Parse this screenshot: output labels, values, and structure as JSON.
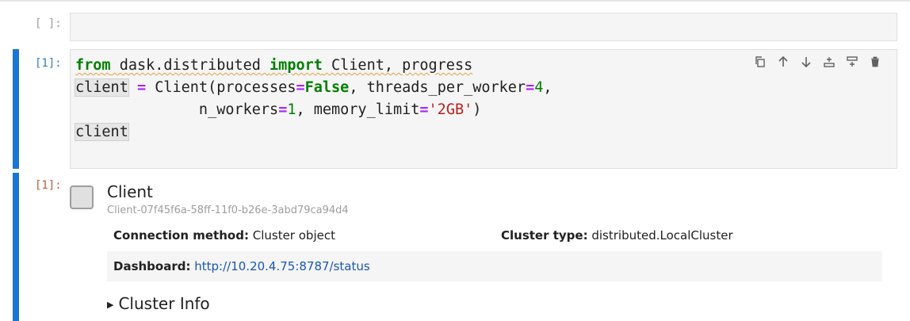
{
  "cells": {
    "empty": {
      "prompt": "[ ]:"
    },
    "code": {
      "prompt": "[1]:",
      "tokens": {
        "from": "from",
        "module": " dask.distributed ",
        "import": "import",
        "imports": " Client, progress",
        "client_var": "client",
        "eq": " = ",
        "call_open": "Client(processes",
        "eq2": "=",
        "false_kw": "False",
        "tpw": ", threads_per_worker",
        "eq3": "=",
        "four": "4",
        "comma_end": ",",
        "indent": "              n_workers",
        "eq4": "=",
        "one": "1",
        "memlim": ", memory_limit",
        "eq5": "=",
        "gb": "'2GB'",
        "close": ")",
        "client_last": "client"
      },
      "toolbar": {
        "copy": "copy-icon",
        "up": "arrow-up-icon",
        "down": "arrow-down-icon",
        "insert_above": "insert-above-icon",
        "insert_below": "insert-below-icon",
        "delete": "delete-icon"
      }
    },
    "output": {
      "prompt": "[1]:",
      "title": "Client",
      "client_id": "Client-07f45f6a-58ff-11f0-b26e-3abd79ca94d4",
      "connection_label": "Connection method:",
      "connection_value": "Cluster object",
      "cluster_type_label": "Cluster type:",
      "cluster_type_value": "distributed.LocalCluster",
      "dashboard_label": "Dashboard:",
      "dashboard_url": "http://10.20.4.75:8787/status",
      "cluster_info": "Cluster Info"
    }
  },
  "colors": {
    "active_bar": "#1976d2",
    "prompt_in": "#307fc1",
    "prompt_out": "#bf5b3d",
    "keyword": "#008000",
    "operator": "#aa22ff",
    "string": "#ba2121",
    "link": "#1a56b8"
  }
}
